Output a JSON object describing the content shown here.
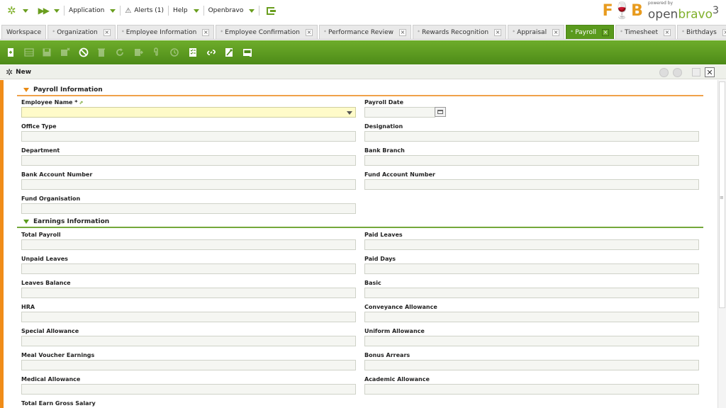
{
  "navbar": {
    "items": [
      {
        "label": "Application"
      },
      {
        "label": "Alerts (1)"
      },
      {
        "label": "Help"
      },
      {
        "label": "Openbravo"
      }
    ],
    "powered_by": "powered by",
    "brand_left": "F",
    "brand_right": "B",
    "openbravo_text_1": "open",
    "openbravo_text_2": "bravo",
    "openbravo_version": "3"
  },
  "tabs": [
    {
      "label": "Workspace",
      "closable": false,
      "active": false,
      "dot": false
    },
    {
      "label": "Organization",
      "closable": true,
      "active": false,
      "dot": true
    },
    {
      "label": "Employee Information",
      "closable": true,
      "active": false,
      "dot": true
    },
    {
      "label": "Employee Confirmation",
      "closable": true,
      "active": false,
      "dot": true
    },
    {
      "label": "Performance Review",
      "closable": true,
      "active": false,
      "dot": true
    },
    {
      "label": "Rewards Recognition",
      "closable": true,
      "active": false,
      "dot": true
    },
    {
      "label": "Appraisal",
      "closable": true,
      "active": false,
      "dot": true
    },
    {
      "label": "Payroll",
      "closable": true,
      "active": true,
      "dot": true
    },
    {
      "label": "Timesheet",
      "closable": true,
      "active": false,
      "dot": true
    },
    {
      "label": "Birthdays",
      "closable": true,
      "active": false,
      "dot": true
    }
  ],
  "toolbar": {
    "buttons": [
      {
        "icon": "new-document-icon",
        "enabled": true
      },
      {
        "icon": "grid-icon",
        "enabled": false
      },
      {
        "icon": "save-icon",
        "enabled": false
      },
      {
        "icon": "save-close-icon",
        "enabled": false
      },
      {
        "icon": "cancel-icon",
        "enabled": true
      },
      {
        "icon": "delete-icon",
        "enabled": false
      },
      {
        "icon": "refresh-icon",
        "enabled": false
      },
      {
        "icon": "export-icon",
        "enabled": false
      },
      {
        "icon": "attach-icon",
        "enabled": false
      },
      {
        "icon": "audit-icon",
        "enabled": false
      },
      {
        "icon": "checklist-icon",
        "enabled": true
      },
      {
        "icon": "link-icon",
        "enabled": true
      },
      {
        "icon": "tools-icon",
        "enabled": true
      },
      {
        "icon": "print-icon",
        "enabled": true
      }
    ]
  },
  "status": {
    "label": "New"
  },
  "sections": {
    "payroll": {
      "title": "Payroll Information",
      "color": "#e98a14"
    },
    "earnings": {
      "title": "Earnings Information",
      "color": "#5b9c1e"
    }
  },
  "fields": {
    "employee_name": {
      "label": "Employee Name",
      "required_mark": "*",
      "value": ""
    },
    "payroll_date": {
      "label": "Payroll Date",
      "value": ""
    },
    "office_type": {
      "label": "Office Type",
      "value": ""
    },
    "designation": {
      "label": "Designation",
      "value": ""
    },
    "department": {
      "label": "Department",
      "value": ""
    },
    "bank_branch": {
      "label": "Bank Branch",
      "value": ""
    },
    "bank_account_number": {
      "label": "Bank Account Number",
      "value": ""
    },
    "fund_account_number": {
      "label": "Fund Account Number",
      "value": ""
    },
    "fund_organisation": {
      "label": "Fund Organisation",
      "value": ""
    },
    "total_payroll": {
      "label": "Total Payroll",
      "value": ""
    },
    "paid_leaves": {
      "label": "Paid Leaves",
      "value": ""
    },
    "unpaid_leaves": {
      "label": "Unpaid Leaves",
      "value": ""
    },
    "paid_days": {
      "label": "Paid Days",
      "value": ""
    },
    "leaves_balance": {
      "label": "Leaves Balance",
      "value": ""
    },
    "basic": {
      "label": "Basic",
      "value": ""
    },
    "hra": {
      "label": "HRA",
      "value": ""
    },
    "conveyance_allowance": {
      "label": "Conveyance Allowance",
      "value": ""
    },
    "special_allowance": {
      "label": "Special Allowance",
      "value": ""
    },
    "uniform_allowance": {
      "label": "Uniform Allowance",
      "value": ""
    },
    "meal_voucher_earnings": {
      "label": "Meal Voucher Earnings",
      "value": ""
    },
    "bonus_arrears": {
      "label": "Bonus Arrears",
      "value": ""
    },
    "medical_allowance": {
      "label": "Medical Allowance",
      "value": ""
    },
    "academic_allowance": {
      "label": "Academic Allowance",
      "value": ""
    },
    "total_earn_gross_salary": {
      "label": "Total Earn Gross Salary",
      "value": ""
    }
  },
  "colors": {
    "accent_green": "#5a9a1d",
    "accent_orange": "#f08c18",
    "required_field_bg": "#fffbc9"
  }
}
